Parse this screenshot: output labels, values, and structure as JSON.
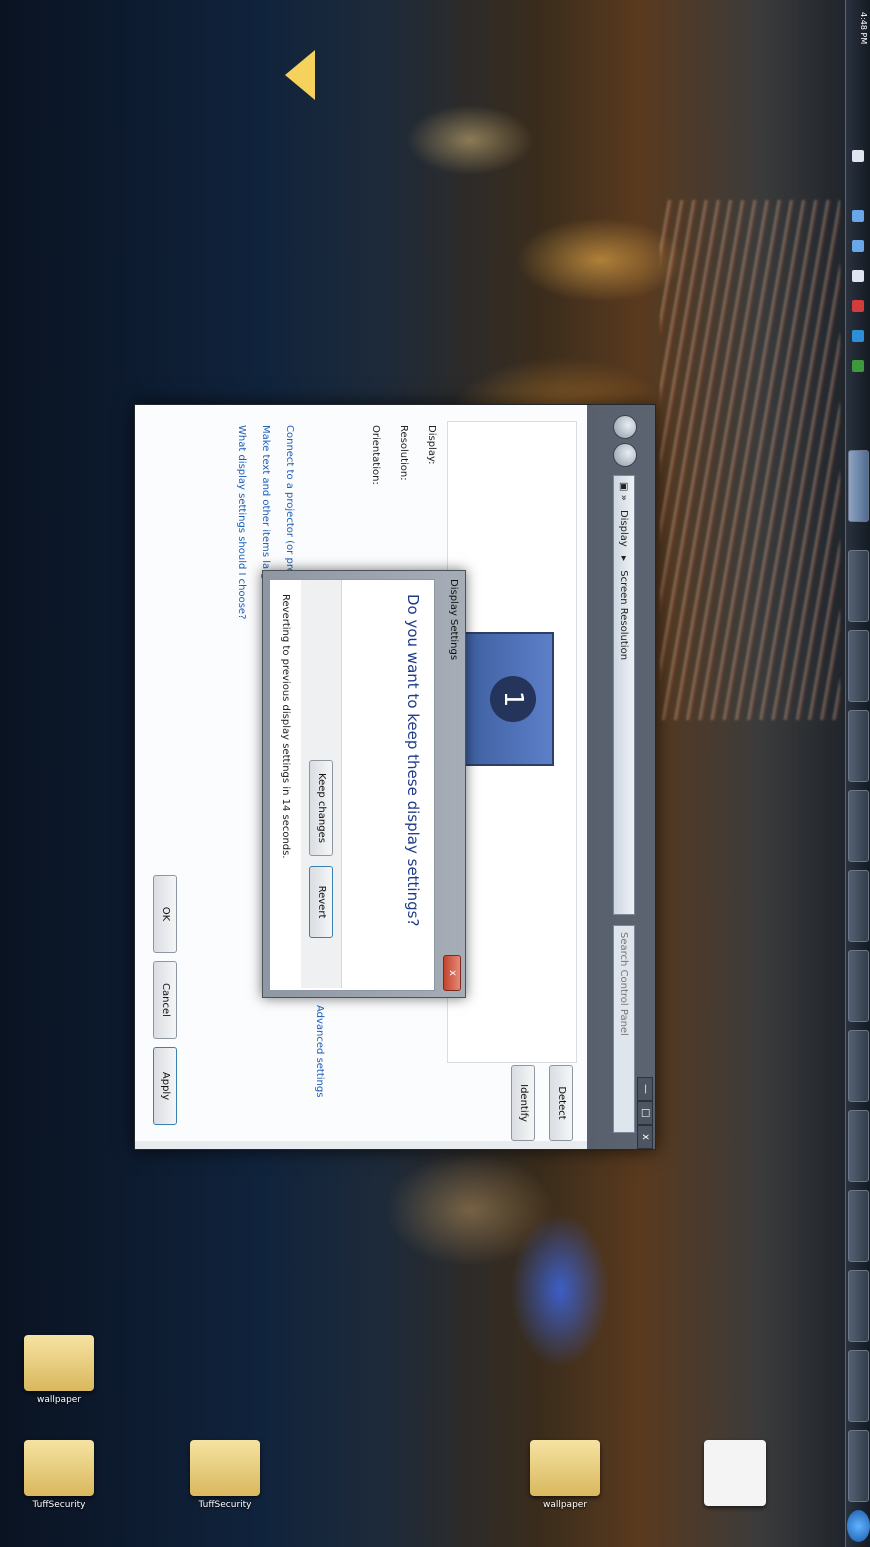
{
  "desktop": {
    "icons": [
      {
        "label": "TuffSecurity",
        "kind": "folder"
      },
      {
        "label": "wallpaper",
        "kind": "folder"
      },
      {
        "label": "TuffSecurity",
        "kind": "folder"
      },
      {
        "label": "wallpaper",
        "kind": "folder"
      },
      {
        "label": "",
        "kind": "file"
      }
    ]
  },
  "window": {
    "breadcrumbs": [
      "Display",
      "Screen Resolution"
    ],
    "search_placeholder": "Search Control Panel",
    "controls": {
      "minimize": "—",
      "maximize": "□",
      "close": "x"
    },
    "preview_number": "1",
    "buttons": {
      "detect": "Detect",
      "identify": "Identify",
      "ok": "OK",
      "cancel": "Cancel",
      "apply": "Apply"
    },
    "fields": {
      "display": "Display:",
      "resolution": "Resolution:",
      "orientation": "Orientation:"
    },
    "advanced_link": "Advanced settings",
    "links": [
      "Connect to a projector (or press the  key and tap P)",
      "Make text and other items larger or smaller",
      "What display settings should I choose?"
    ]
  },
  "dialog": {
    "title": "Display Settings",
    "close": "x",
    "question": "Do you want to keep these display settings?",
    "keep": "Keep changes",
    "revert": "Revert",
    "countdown": "Reverting to previous display settings in 14 seconds."
  },
  "taskbar": {
    "clock": "4:48 PM",
    "items": [
      "",
      "",
      "",
      "",
      "",
      "",
      "",
      "",
      "",
      ""
    ]
  }
}
